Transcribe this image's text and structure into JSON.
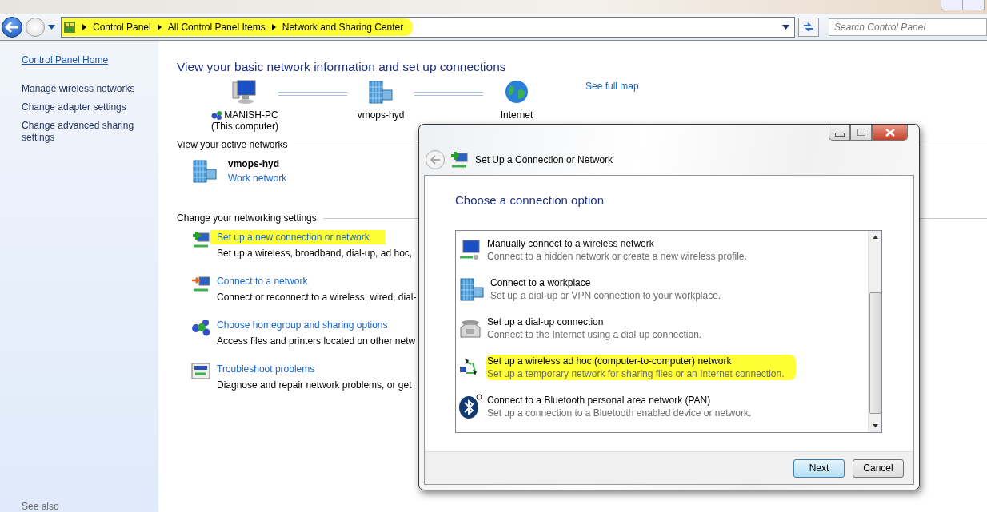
{
  "address_bar": {
    "highlighted": true,
    "breadcrumbs": [
      "Control Panel",
      "All Control Panel Items",
      "Network and Sharing Center"
    ]
  },
  "search": {
    "placeholder": "Search Control Panel"
  },
  "sidebar": {
    "home_link": "Control Panel Home",
    "items": [
      "Manage wireless networks",
      "Change adapter settings",
      "Change advanced sharing settings"
    ],
    "see_also": "See also"
  },
  "main": {
    "title": "View your basic network information and set up connections",
    "map": {
      "nodes": [
        {
          "kind": "computer",
          "name": "MANISH-PC",
          "subtitle": "(This computer)"
        },
        {
          "kind": "network",
          "name": "vmops-hyd"
        },
        {
          "kind": "internet",
          "name": "Internet"
        }
      ],
      "see_full_map": "See full map"
    },
    "active_networks": {
      "heading": "View your active networks",
      "networks": [
        {
          "name": "vmops-hyd",
          "type": "Work network"
        }
      ]
    },
    "settings": {
      "heading": "Change your networking settings",
      "tasks": [
        {
          "kind": "new-connection",
          "link": "Set up a new connection or network",
          "description": "Set up a wireless, broadband, dial-up, ad hoc,",
          "highlighted": true
        },
        {
          "kind": "connect",
          "link": "Connect to a network",
          "description": "Connect or reconnect to a wireless, wired, dial-",
          "highlighted": false
        },
        {
          "kind": "homegroup",
          "link": "Choose homegroup and sharing options",
          "description": "Access files and printers located on other netw",
          "highlighted": false
        },
        {
          "kind": "troubleshoot",
          "link": "Troubleshoot problems",
          "description": "Diagnose and repair network problems, or get",
          "highlighted": false
        }
      ]
    }
  },
  "dialog": {
    "title": "Set Up a Connection or Network",
    "heading": "Choose a connection option",
    "options": [
      {
        "kind": "wireless",
        "title": "Manually connect to a wireless network",
        "description": "Connect to a hidden network or create a new wireless profile.",
        "highlighted": false
      },
      {
        "kind": "workplace",
        "title": "Connect to a workplace",
        "description": "Set up a dial-up or VPN connection to your workplace.",
        "highlighted": false
      },
      {
        "kind": "dialup",
        "title": "Set up a dial-up connection",
        "description": "Connect to the Internet using a dial-up connection.",
        "highlighted": false
      },
      {
        "kind": "adhoc",
        "title": "Set up a wireless ad hoc (computer-to-computer) network",
        "description": "Set up a temporary network for sharing files or an Internet connection.",
        "highlighted": true
      },
      {
        "kind": "bluetooth",
        "title": "Connect to a Bluetooth personal area network (PAN)",
        "description": "Set up a connection to a Bluetooth enabled device or network.",
        "highlighted": false
      }
    ],
    "buttons": [
      {
        "label": "Next",
        "default": true
      },
      {
        "label": "Cancel",
        "default": false
      }
    ]
  }
}
